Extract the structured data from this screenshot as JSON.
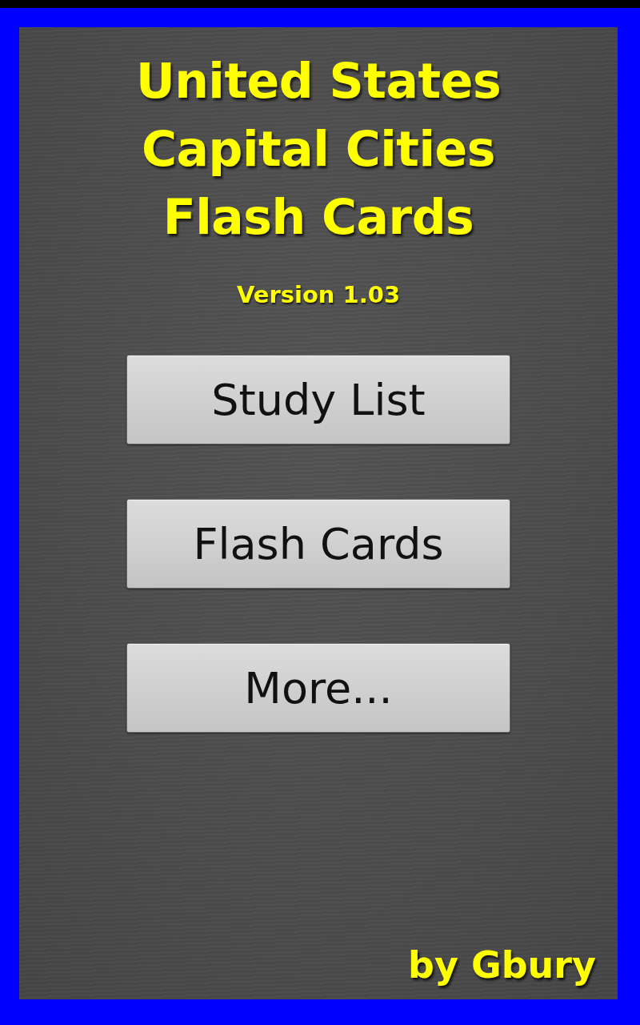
{
  "title_lines": [
    "United States",
    "Capital Cities",
    "Flash Cards"
  ],
  "version": "Version 1.03",
  "buttons": [
    "Study List",
    "Flash Cards",
    "More..."
  ],
  "author": "by Gbury"
}
